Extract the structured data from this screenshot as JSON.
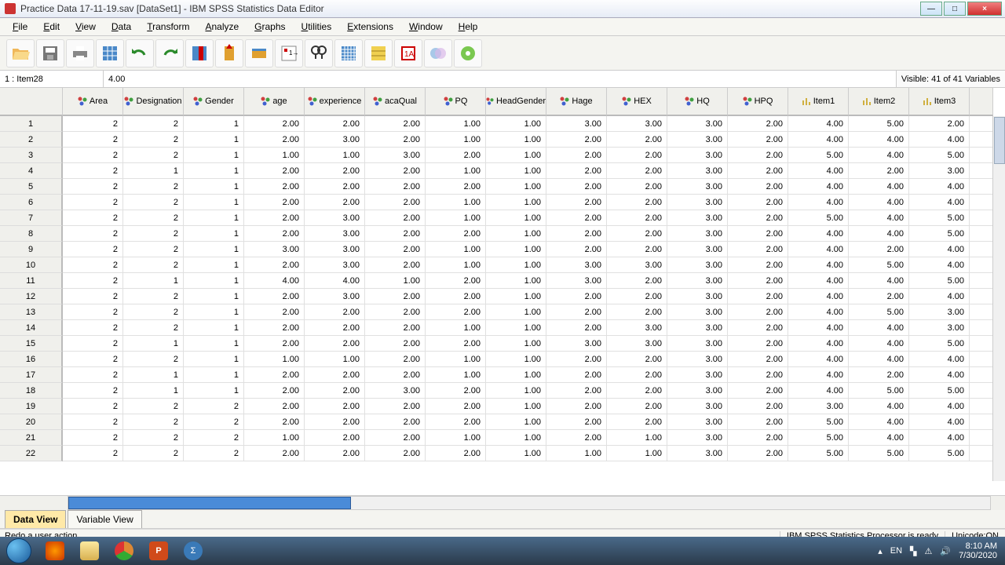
{
  "title": "Practice Data 17-11-19.sav [DataSet1] - IBM SPSS Statistics Data Editor",
  "menu": [
    "File",
    "Edit",
    "View",
    "Data",
    "Transform",
    "Analyze",
    "Graphs",
    "Utilities",
    "Extensions",
    "Window",
    "Help"
  ],
  "toolbar_icons": [
    "open",
    "save",
    "print",
    "data",
    "undo",
    "redo",
    "goto",
    "insertvar",
    "insertcase",
    "variables",
    "find",
    "split",
    "weight",
    "select",
    "valuelabels",
    "usesets"
  ],
  "cell_addr": "1 : Item28",
  "cell_value": "4.00",
  "visible": "Visible: 41 of 41 Variables",
  "columns": [
    {
      "name": "Area",
      "type": "nom"
    },
    {
      "name": "Designation",
      "type": "nom"
    },
    {
      "name": "Gender",
      "type": "nom"
    },
    {
      "name": "age",
      "type": "nom"
    },
    {
      "name": "experience",
      "type": "nom"
    },
    {
      "name": "acaQual",
      "type": "nom"
    },
    {
      "name": "PQ",
      "type": "nom"
    },
    {
      "name": "HeadGender",
      "type": "nom"
    },
    {
      "name": "Hage",
      "type": "nom"
    },
    {
      "name": "HEX",
      "type": "nom"
    },
    {
      "name": "HQ",
      "type": "nom"
    },
    {
      "name": "HPQ",
      "type": "nom"
    },
    {
      "name": "Item1",
      "type": "sc"
    },
    {
      "name": "Item2",
      "type": "sc"
    },
    {
      "name": "Item3",
      "type": "sc"
    }
  ],
  "row_labels": [
    "1",
    "2",
    "3",
    "4",
    "5",
    "6",
    "7",
    "8",
    "9",
    "10",
    "11",
    "12",
    "13",
    "14",
    "15",
    "16",
    "17",
    "18",
    "19",
    "20",
    "21",
    "22"
  ],
  "chart_data": {
    "type": "table",
    "columns": [
      "Area",
      "Designation",
      "Gender",
      "age",
      "experience",
      "acaQual",
      "PQ",
      "HeadGender",
      "Hage",
      "HEX",
      "HQ",
      "HPQ",
      "Item1",
      "Item2",
      "Item3"
    ],
    "rows": [
      [
        2,
        2,
        1,
        "2.00",
        "2.00",
        "2.00",
        "1.00",
        "1.00",
        "3.00",
        "3.00",
        "3.00",
        "2.00",
        "4.00",
        "5.00",
        "2.00"
      ],
      [
        2,
        2,
        1,
        "2.00",
        "3.00",
        "2.00",
        "1.00",
        "1.00",
        "2.00",
        "2.00",
        "3.00",
        "2.00",
        "4.00",
        "4.00",
        "4.00"
      ],
      [
        2,
        2,
        1,
        "1.00",
        "1.00",
        "3.00",
        "2.00",
        "1.00",
        "2.00",
        "2.00",
        "3.00",
        "2.00",
        "5.00",
        "4.00",
        "5.00"
      ],
      [
        2,
        1,
        1,
        "2.00",
        "2.00",
        "2.00",
        "1.00",
        "1.00",
        "2.00",
        "2.00",
        "3.00",
        "2.00",
        "4.00",
        "2.00",
        "3.00"
      ],
      [
        2,
        2,
        1,
        "2.00",
        "2.00",
        "2.00",
        "2.00",
        "1.00",
        "2.00",
        "2.00",
        "3.00",
        "2.00",
        "4.00",
        "4.00",
        "4.00"
      ],
      [
        2,
        2,
        1,
        "2.00",
        "2.00",
        "2.00",
        "1.00",
        "1.00",
        "2.00",
        "2.00",
        "3.00",
        "2.00",
        "4.00",
        "4.00",
        "4.00"
      ],
      [
        2,
        2,
        1,
        "2.00",
        "3.00",
        "2.00",
        "1.00",
        "1.00",
        "2.00",
        "2.00",
        "3.00",
        "2.00",
        "5.00",
        "4.00",
        "5.00"
      ],
      [
        2,
        2,
        1,
        "2.00",
        "3.00",
        "2.00",
        "2.00",
        "1.00",
        "2.00",
        "2.00",
        "3.00",
        "2.00",
        "4.00",
        "4.00",
        "5.00"
      ],
      [
        2,
        2,
        1,
        "3.00",
        "3.00",
        "2.00",
        "1.00",
        "1.00",
        "2.00",
        "2.00",
        "3.00",
        "2.00",
        "4.00",
        "2.00",
        "4.00"
      ],
      [
        2,
        2,
        1,
        "2.00",
        "3.00",
        "2.00",
        "1.00",
        "1.00",
        "3.00",
        "3.00",
        "3.00",
        "2.00",
        "4.00",
        "5.00",
        "4.00"
      ],
      [
        2,
        1,
        1,
        "4.00",
        "4.00",
        "1.00",
        "2.00",
        "1.00",
        "3.00",
        "2.00",
        "3.00",
        "2.00",
        "4.00",
        "4.00",
        "5.00"
      ],
      [
        2,
        2,
        1,
        "2.00",
        "3.00",
        "2.00",
        "2.00",
        "1.00",
        "2.00",
        "2.00",
        "3.00",
        "2.00",
        "4.00",
        "2.00",
        "4.00"
      ],
      [
        2,
        2,
        1,
        "2.00",
        "2.00",
        "2.00",
        "2.00",
        "1.00",
        "2.00",
        "2.00",
        "3.00",
        "2.00",
        "4.00",
        "5.00",
        "3.00"
      ],
      [
        2,
        2,
        1,
        "2.00",
        "2.00",
        "2.00",
        "1.00",
        "1.00",
        "2.00",
        "3.00",
        "3.00",
        "2.00",
        "4.00",
        "4.00",
        "3.00"
      ],
      [
        2,
        1,
        1,
        "2.00",
        "2.00",
        "2.00",
        "2.00",
        "1.00",
        "3.00",
        "3.00",
        "3.00",
        "2.00",
        "4.00",
        "4.00",
        "5.00"
      ],
      [
        2,
        2,
        1,
        "1.00",
        "1.00",
        "2.00",
        "1.00",
        "1.00",
        "2.00",
        "2.00",
        "3.00",
        "2.00",
        "4.00",
        "4.00",
        "4.00"
      ],
      [
        2,
        1,
        1,
        "2.00",
        "2.00",
        "2.00",
        "1.00",
        "1.00",
        "2.00",
        "2.00",
        "3.00",
        "2.00",
        "4.00",
        "2.00",
        "4.00"
      ],
      [
        2,
        1,
        1,
        "2.00",
        "2.00",
        "3.00",
        "2.00",
        "1.00",
        "2.00",
        "2.00",
        "3.00",
        "2.00",
        "4.00",
        "5.00",
        "5.00"
      ],
      [
        2,
        2,
        2,
        "2.00",
        "2.00",
        "2.00",
        "2.00",
        "1.00",
        "2.00",
        "2.00",
        "3.00",
        "2.00",
        "3.00",
        "4.00",
        "4.00"
      ],
      [
        2,
        2,
        2,
        "2.00",
        "2.00",
        "2.00",
        "2.00",
        "1.00",
        "2.00",
        "2.00",
        "3.00",
        "2.00",
        "5.00",
        "4.00",
        "4.00"
      ],
      [
        2,
        2,
        2,
        "1.00",
        "2.00",
        "2.00",
        "1.00",
        "1.00",
        "2.00",
        "1.00",
        "3.00",
        "2.00",
        "5.00",
        "4.00",
        "4.00"
      ],
      [
        2,
        2,
        2,
        "2.00",
        "2.00",
        "2.00",
        "2.00",
        "1.00",
        "1.00",
        "1.00",
        "3.00",
        "2.00",
        "5.00",
        "5.00",
        "5.00"
      ]
    ]
  },
  "tabs": {
    "data_view": "Data View",
    "variable_view": "Variable View"
  },
  "status_left": "Redo a user action",
  "status_mid": "IBM SPSS Statistics Processor is ready",
  "status_uni": "Unicode:ON",
  "tray": {
    "lang": "EN",
    "time": "8:10 AM",
    "date": "7/30/2020"
  }
}
